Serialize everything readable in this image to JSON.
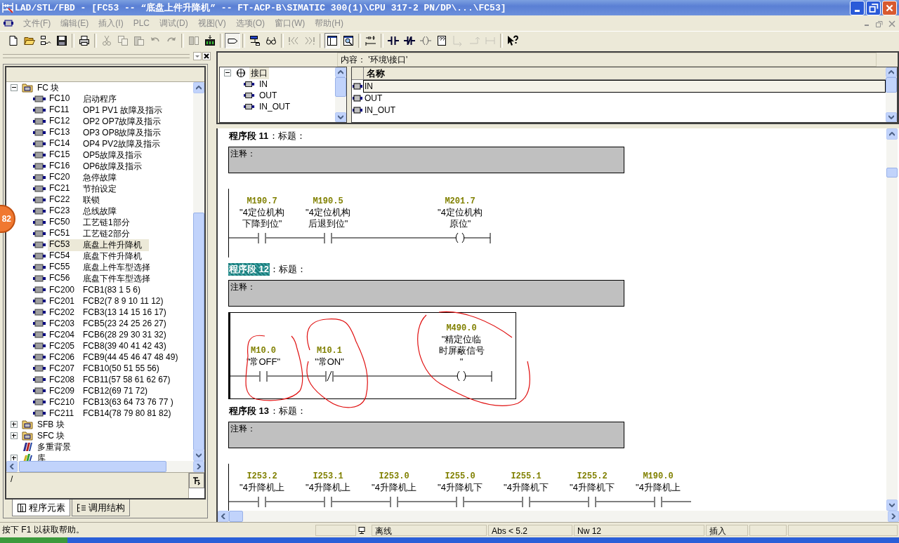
{
  "window": {
    "title": "LAD/STL/FBD  - [FC53 -- “底盘上件升降机” -- FT-ACP-B\\SIMATIC 300(1)\\CPU 317-2 PN/DP\\...\\FC53]"
  },
  "menu": [
    "文件(F)",
    "编辑(E)",
    "插入(I)",
    "PLC",
    "调试(D)",
    "视图(V)",
    "选项(O)",
    "窗口(W)",
    "帮助(H)"
  ],
  "toolbar": [
    {
      "disabled": false,
      "pressed": false
    },
    {
      "disabled": false,
      "pressed": false
    },
    {
      "disabled": false,
      "pressed": false
    },
    {
      "disabled": false,
      "pressed": false
    },
    {
      "disabled": false,
      "pressed": false
    },
    {
      "disabled": true,
      "pressed": false
    },
    {
      "disabled": true,
      "pressed": false
    },
    {
      "disabled": true,
      "pressed": false
    },
    {
      "disabled": true,
      "pressed": false
    },
    {
      "disabled": true,
      "pressed": false
    },
    {
      "disabled": true,
      "pressed": false
    },
    {
      "disabled": false,
      "pressed": false
    },
    {
      "disabled": false,
      "pressed": true
    },
    {
      "disabled": false,
      "pressed": false
    },
    {
      "disabled": false,
      "pressed": false
    },
    {
      "disabled": true,
      "pressed": false
    },
    {
      "disabled": true,
      "pressed": false
    },
    {
      "disabled": false,
      "pressed": true
    },
    {
      "disabled": false,
      "pressed": false
    },
    {
      "disabled": false,
      "pressed": false
    },
    {
      "disabled": false,
      "pressed": false
    },
    {
      "disabled": false,
      "pressed": false
    },
    {
      "disabled": false,
      "pressed": false
    },
    {
      "disabled": false,
      "pressed": false
    },
    {
      "disabled": true,
      "pressed": false
    },
    {
      "disabled": true,
      "pressed": false
    },
    {
      "disabled": true,
      "pressed": false
    },
    {
      "disabled": false,
      "pressed": false
    }
  ],
  "program_tree": {
    "items": [
      {
        "kind": "folder",
        "label": "FC 块",
        "expanded": true,
        "children": [
          {
            "name": "FC10",
            "comment": "启动程序",
            "selected": false
          },
          {
            "name": "FC11",
            "comment": "OP1 PV1 故障及指示",
            "selected": false
          },
          {
            "name": "FC12",
            "comment": "OP2 OP7故障及指示",
            "selected": false
          },
          {
            "name": "FC13",
            "comment": "OP3 OP8故障及指示",
            "selected": false
          },
          {
            "name": "FC14",
            "comment": "OP4 PV2故障及指示",
            "selected": false
          },
          {
            "name": "FC15",
            "comment": "OP5故障及指示",
            "selected": false
          },
          {
            "name": "FC16",
            "comment": "OP6故障及指示",
            "selected": false
          },
          {
            "name": "FC20",
            "comment": "急停故障",
            "selected": false
          },
          {
            "name": "FC21",
            "comment": "节拍设定",
            "selected": false
          },
          {
            "name": "FC22",
            "comment": "联锁",
            "selected": false
          },
          {
            "name": "FC23",
            "comment": "总线故障",
            "selected": false
          },
          {
            "name": "FC50",
            "comment": "工艺链1部分",
            "selected": false
          },
          {
            "name": "FC51",
            "comment": "工艺链2部分",
            "selected": false
          },
          {
            "name": "FC53",
            "comment": "底盘上件升降机",
            "selected": true
          },
          {
            "name": "FC54",
            "comment": "底盘下件升降机",
            "selected": false
          },
          {
            "name": "FC55",
            "comment": "底盘上件车型选择",
            "selected": false
          },
          {
            "name": "FC56",
            "comment": "底盘下件车型选择",
            "selected": false
          },
          {
            "name": "FC200",
            "comment": "FCB1(83 1 5 6)",
            "selected": false
          },
          {
            "name": "FC201",
            "comment": "FCB2(7 8 9 10 11 12)",
            "selected": false
          },
          {
            "name": "FC202",
            "comment": "FCB3(13 14 15 16 17)",
            "selected": false
          },
          {
            "name": "FC203",
            "comment": "FCB5(23 24 25 26 27)",
            "selected": false
          },
          {
            "name": "FC204",
            "comment": "FCB6(28 29 30 31 32)",
            "selected": false
          },
          {
            "name": "FC205",
            "comment": "FCB8(39 40 41 42 43)",
            "selected": false
          },
          {
            "name": "FC206",
            "comment": "FCB9(44 45 46 47 48 49)",
            "selected": false
          },
          {
            "name": "FC207",
            "comment": "FCB10(50 51 55 56)",
            "selected": false
          },
          {
            "name": "FC208",
            "comment": "FCB11(57 58 61 62 67)",
            "selected": false
          },
          {
            "name": "FC209",
            "comment": "FCB12(69 71 72)",
            "selected": false
          },
          {
            "name": "FC210",
            "comment": "FCB13(63 64 73 76 77 )",
            "selected": false
          },
          {
            "name": "FC211",
            "comment": "FCB14(78 79 80 81 82)",
            "selected": false
          }
        ]
      },
      {
        "kind": "folder",
        "label": "SFB 块",
        "expanded": false
      },
      {
        "kind": "folder",
        "label": "SFC 块",
        "expanded": false
      },
      {
        "kind": "multi_instance",
        "label": "多重背景"
      },
      {
        "kind": "library",
        "label": "库",
        "expanded": false
      }
    ]
  },
  "path_field": {
    "value": "/"
  },
  "panel_tabs": [
    {
      "label": "程序元素",
      "selected": true
    },
    {
      "label": "调用结构",
      "selected": false
    }
  ],
  "badge": "82",
  "interface": {
    "content_label": "内容：  '环境\\接口'",
    "tree": {
      "label": "接口",
      "expanded": true,
      "selected": true,
      "children": [
        {
          "label": "IN",
          "selected": false
        },
        {
          "label": "OUT",
          "selected": false
        },
        {
          "label": "IN_OUT",
          "selected": false
        }
      ]
    },
    "table": {
      "column": "名称",
      "rows": [
        {
          "name": "IN",
          "selected": true
        },
        {
          "name": "OUT",
          "selected": false
        },
        {
          "name": "IN_OUT",
          "selected": false
        }
      ]
    }
  },
  "networks": [
    {
      "number_label": "程序段 11",
      "title": "：标题：",
      "selected": false,
      "comment": "注释：",
      "elements": [
        {
          "kind": "contact",
          "address": "M190.7",
          "symbol": [
            "\"4定位机构",
            "下降到位\""
          ]
        },
        {
          "kind": "contact",
          "address": "M190.5",
          "symbol": [
            "\"4定位机构",
            "后退到位\""
          ]
        },
        {
          "kind": "wire"
        },
        {
          "kind": "coil",
          "address": "M201.7",
          "symbol": [
            "\"4定位机构",
            "原位\""
          ]
        }
      ]
    },
    {
      "number_label": "程序段 12",
      "title": "：标题：",
      "selected": true,
      "comment": "注释：",
      "elements": [
        {
          "kind": "contact",
          "address": "M10.0",
          "symbol": [
            "\"常OFF\""
          ]
        },
        {
          "kind": "closed_contact",
          "address": "M10.1",
          "symbol": [
            "\"常ON\""
          ]
        },
        {
          "kind": "wire"
        },
        {
          "kind": "coil",
          "address": "M490.0",
          "symbol": [
            "\"精定位临",
            "时屏蔽信号",
            "\""
          ]
        }
      ]
    },
    {
      "number_label": "程序段 13",
      "title": "：标题：",
      "selected": false,
      "comment": "注释：",
      "elements": [
        {
          "kind": "contact",
          "address": "I253.2",
          "symbol": [
            "\"4升降机上"
          ]
        },
        {
          "kind": "contact",
          "address": "I253.1",
          "symbol": [
            "\"4升降机上"
          ]
        },
        {
          "kind": "contact",
          "address": "I253.0",
          "symbol": [
            "\"4升降机上"
          ]
        },
        {
          "kind": "contact",
          "address": "I255.0",
          "symbol": [
            "\"4升降机下"
          ]
        },
        {
          "kind": "contact",
          "address": "I255.1",
          "symbol": [
            "\"4升降机下"
          ]
        },
        {
          "kind": "contact",
          "address": "I255.2",
          "symbol": [
            "\"4升降机下"
          ]
        },
        {
          "kind": "contact",
          "address": "M190.0",
          "symbol": [
            "\"4升降机上"
          ]
        }
      ]
    }
  ],
  "status_bar": {
    "help": "按下 F1 以获取帮助。",
    "mode": "离线",
    "address": "Abs < 5.2",
    "network": "Nw 12",
    "insert": "插入"
  }
}
